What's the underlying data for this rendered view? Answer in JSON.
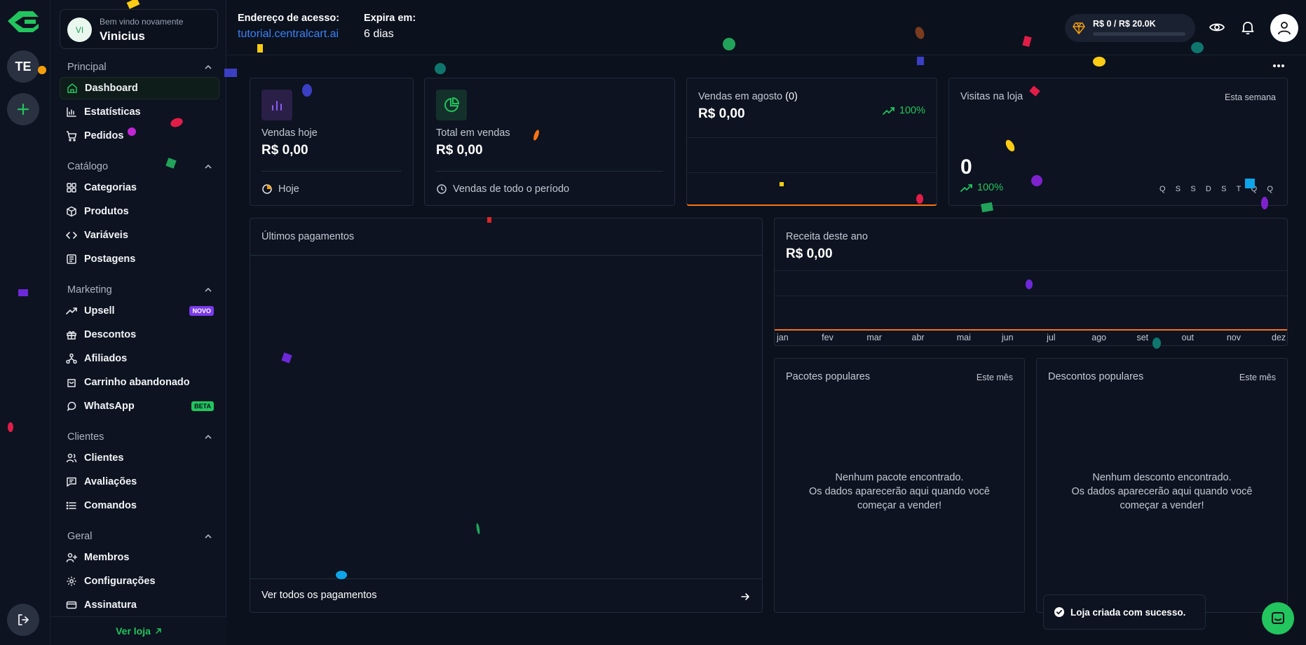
{
  "rail": {
    "store_initials": "TE"
  },
  "welcome": {
    "avatar_initials": "VI",
    "greeting": "Bem vindo novamente",
    "user_name": "Vinicius"
  },
  "nav": {
    "sections": [
      {
        "title": "Principal",
        "items": [
          "Dashboard",
          "Estatísticas",
          "Pedidos"
        ]
      },
      {
        "title": "Catálogo",
        "items": [
          "Categorias",
          "Produtos",
          "Variáveis",
          "Postagens"
        ]
      },
      {
        "title": "Marketing",
        "items": [
          "Upsell",
          "Descontos",
          "Afiliados",
          "Carrinho abandonado",
          "WhatsApp"
        ]
      },
      {
        "title": "Clientes",
        "items": [
          "Clientes",
          "Avaliações",
          "Comandos"
        ]
      },
      {
        "title": "Geral",
        "items": [
          "Membros",
          "Configurações",
          "Assinatura"
        ]
      }
    ],
    "badges": {
      "novo": "NOVO",
      "beta": "BETA"
    },
    "footer_link": "Ver loja"
  },
  "header": {
    "address_label": "Endereço de acesso:",
    "address_link": "tutorial.centralcart.ai",
    "expires_label": "Expira em:",
    "expires_value": "6 dias",
    "goal_text": "R$ 0 / R$ 20.0K",
    "goal_progress": 0
  },
  "cards": {
    "sales_today": {
      "title": "Vendas hoje",
      "value": "R$ 0,00",
      "footnote": "Hoje"
    },
    "total_sales": {
      "title": "Total em vendas",
      "value": "R$ 0,00",
      "footnote": "Vendas de todo o período"
    },
    "month_sales": {
      "title": "Vendas em agosto",
      "count": "(0)",
      "value": "R$ 0,00",
      "pct": "100%"
    },
    "visits": {
      "title": "Visitas na loja",
      "period": "Esta semana",
      "value": "0",
      "pct": "100%",
      "weekdays": [
        "Q",
        "S",
        "S",
        "D",
        "S",
        "T",
        "Q",
        "Q"
      ]
    },
    "payments": {
      "title": "Últimos pagamentos",
      "footer": "Ver todos os pagamentos"
    },
    "revenue": {
      "title": "Receita deste ano",
      "value": "R$ 0,00",
      "months": [
        "jan",
        "fev",
        "mar",
        "abr",
        "mai",
        "jun",
        "jul",
        "ago",
        "set",
        "out",
        "nov",
        "dez"
      ]
    },
    "packages": {
      "title": "Pacotes populares",
      "period": "Este mês",
      "empty_line1": "Nenhum pacote encontrado.",
      "empty_line2": "Os dados aparecerão aqui quando você",
      "empty_line3": "começar a vender!"
    },
    "discounts": {
      "title": "Descontos populares",
      "period": "Este mês",
      "empty_line1": "Nenhum desconto encontrado.",
      "empty_line2": "Os dados aparecerão aqui quando você",
      "empty_line3": "começar a vender!"
    }
  },
  "toast": {
    "message": "Loja criada com sucesso."
  },
  "colors": {
    "accent": "#22c55e",
    "link": "#3b82f6",
    "purple": "#7c3aed",
    "chart_line": "#f97316"
  }
}
